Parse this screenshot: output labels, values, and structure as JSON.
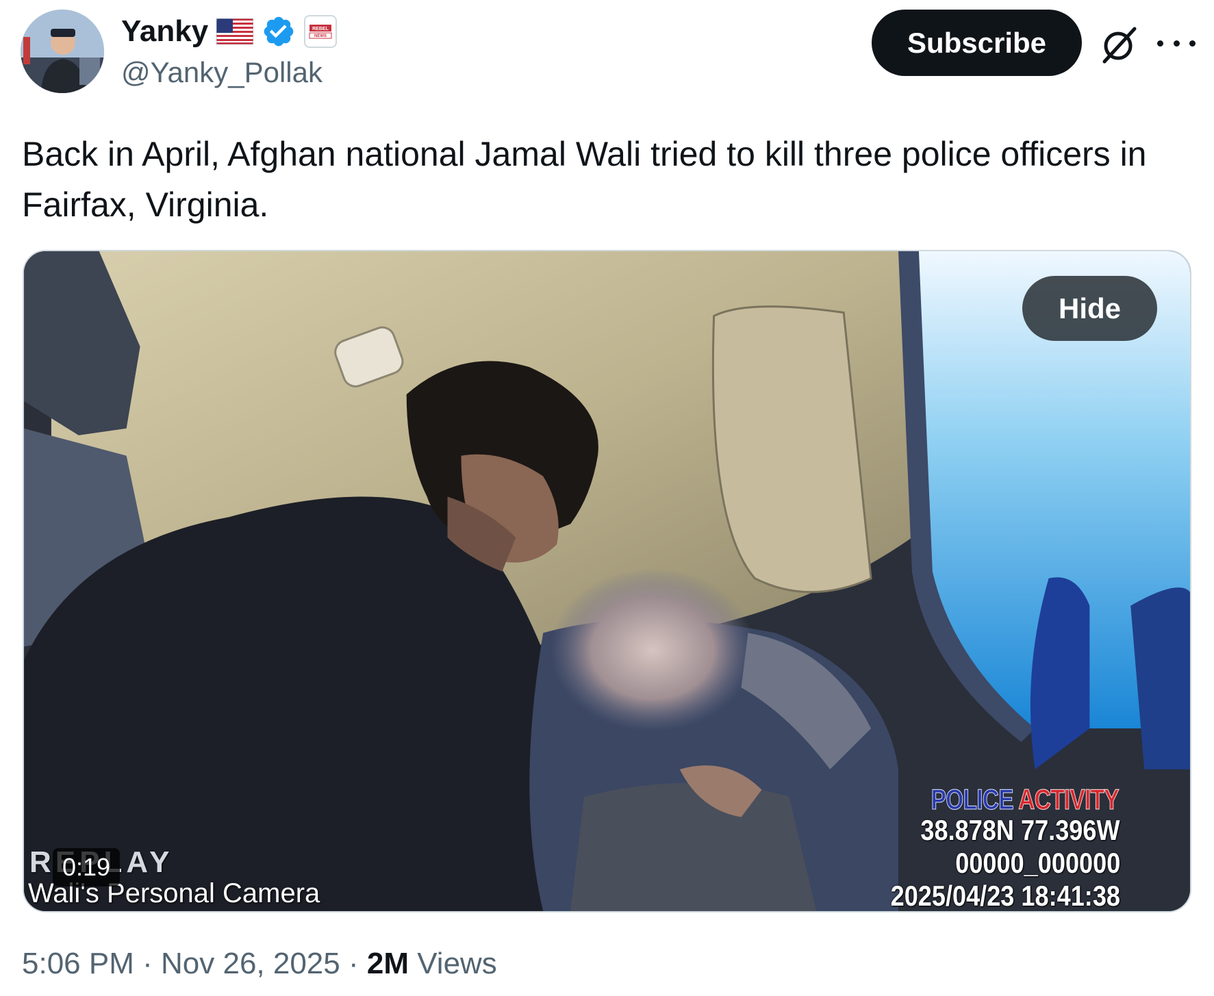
{
  "author": {
    "display_name": "Yanky",
    "handle": "@Yanky_Pollak",
    "badges": [
      "us-flag-icon",
      "verified-badge-icon",
      "rebel-news-affiliate-icon"
    ],
    "affiliate_label": "REBEL NEWS"
  },
  "header": {
    "subscribe_label": "Subscribe",
    "icons": [
      "grok-icon",
      "more-icon"
    ]
  },
  "tweet": {
    "text": "Back in April, Afghan national Jamal Wali tried to kill three police officers in Fairfax, Virginia."
  },
  "media": {
    "hide_label": "Hide",
    "duration": "0:19",
    "watermark_replay": "REPLAY",
    "caption": "Wali's Personal Camera",
    "overlay": {
      "police": "POLICE",
      "activity": "ACTIVITY",
      "coords": "38.878N 77.396W",
      "id": "00000_000000",
      "timestamp": "2025/04/23 18:41:38"
    }
  },
  "meta": {
    "time": "5:06 PM",
    "separator": "·",
    "date": "Nov 26, 2025",
    "views_count": "2M",
    "views_label": "Views"
  },
  "colors": {
    "text_primary": "#0f1419",
    "text_secondary": "#536471",
    "verified_blue": "#1d9bf0",
    "police_blue": "#2a3aa8",
    "activity_red": "#d4282e"
  }
}
